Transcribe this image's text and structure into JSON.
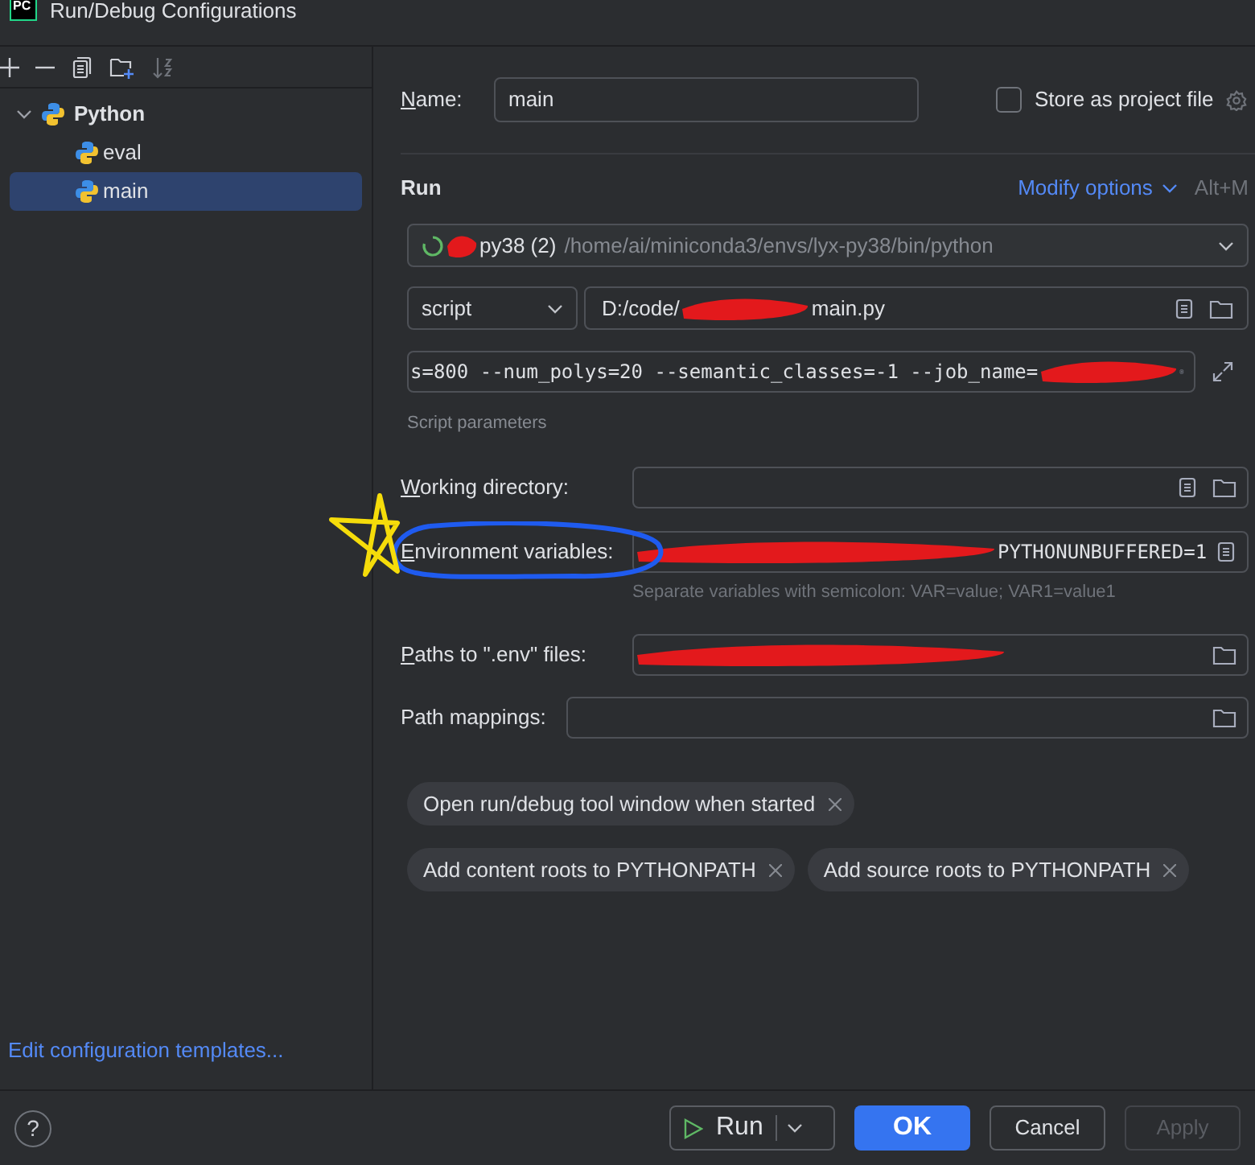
{
  "window": {
    "title": "Run/Debug Configurations",
    "app_badge": "PC"
  },
  "tree": [
    {
      "label": "Python",
      "expanded": true,
      "selected": false,
      "children": [
        {
          "label": "eval",
          "selected": false
        },
        {
          "label": "main",
          "selected": true
        }
      ]
    }
  ],
  "templates_link": "Edit configuration templates...",
  "name_field": {
    "label": "Name:",
    "value": "main"
  },
  "store_option": {
    "label": "Store as project file",
    "checked": false
  },
  "section": "Run",
  "modify_options": {
    "label": "Modify options",
    "shortcut": "Alt+M"
  },
  "interpreter": {
    "segments": [
      {
        "kind": "redaction"
      },
      {
        "kind": "text",
        "text": "py38 (2)"
      }
    ],
    "path": "/home/ai/miniconda3/envs/lyx-py38/bin/python"
  },
  "target_type": "script",
  "script_path": [
    {
      "kind": "text",
      "text": "D:/code/"
    },
    {
      "kind": "redaction"
    },
    {
      "kind": "text",
      "text": "main.py"
    }
  ],
  "parameters": {
    "segments": [
      {
        "kind": "text",
        "text": "s=800 --num_polys=20 --semantic_classes=-1 --job_name="
      },
      {
        "kind": "redaction"
      }
    ],
    "caption": "Script parameters"
  },
  "fields": [
    {
      "label": "Working directory:",
      "kind": "directory"
    },
    {
      "label": "Environment variables:",
      "kind": "environment",
      "segments": [
        {
          "kind": "redaction"
        },
        {
          "kind": "text",
          "text": "PYTHONUNBUFFERED=1"
        }
      ],
      "hint": "Separate variables with semicolon: VAR=value; VAR1=value1"
    },
    {
      "label": "Paths to \".env\" files:",
      "kind": "files",
      "segments": [
        {
          "kind": "redaction"
        }
      ]
    }
  ],
  "path_mappings": {
    "label": "Path mappings:"
  },
  "chips": [
    [
      "Open run/debug tool window when started"
    ],
    [
      "Add content roots to PYTHONPATH",
      "Add source roots to PYTHONPATH"
    ]
  ],
  "annotations": [
    {
      "kind": "ellipse",
      "color": "#1f5bef"
    },
    {
      "kind": "star",
      "color": "#f5dc0a"
    }
  ],
  "help": "?",
  "buttons": [
    {
      "label": "Run",
      "kind": "split",
      "disabled": false
    },
    {
      "label": "OK",
      "kind": "primary",
      "disabled": false
    },
    {
      "label": "Cancel",
      "kind": "plain",
      "disabled": false
    },
    {
      "label": "Apply",
      "kind": "plain",
      "disabled": true
    }
  ]
}
